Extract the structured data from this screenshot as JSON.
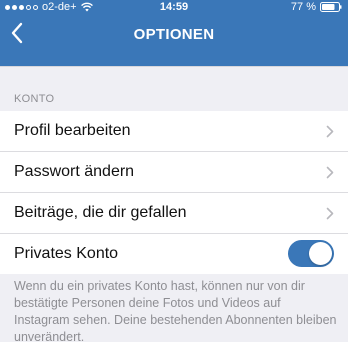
{
  "status_bar": {
    "carrier": "o2-de+",
    "time": "14:59",
    "battery": "77 %"
  },
  "nav": {
    "title": "OPTIONEN"
  },
  "section": {
    "header": "KONTO"
  },
  "rows": [
    {
      "label": "Profil bearbeiten"
    },
    {
      "label": "Passwort ändern"
    },
    {
      "label": "Beiträge, die dir gefallen"
    },
    {
      "label": "Privates Konto"
    }
  ],
  "private_account": {
    "enabled": true,
    "description": "Wenn du ein privates Konto hast, können nur von dir bestätigte Personen deine Fotos und Videos auf Instagram sehen. Deine bestehenden Abonnenten bleiben unverändert."
  },
  "colors": {
    "accent": "#3a77b8",
    "background": "#efeff4",
    "secondary_text": "#8e8e93"
  },
  "icons": [
    "wifi-icon",
    "battery-icon",
    "back-chevron-icon",
    "chevron-right-icon"
  ]
}
